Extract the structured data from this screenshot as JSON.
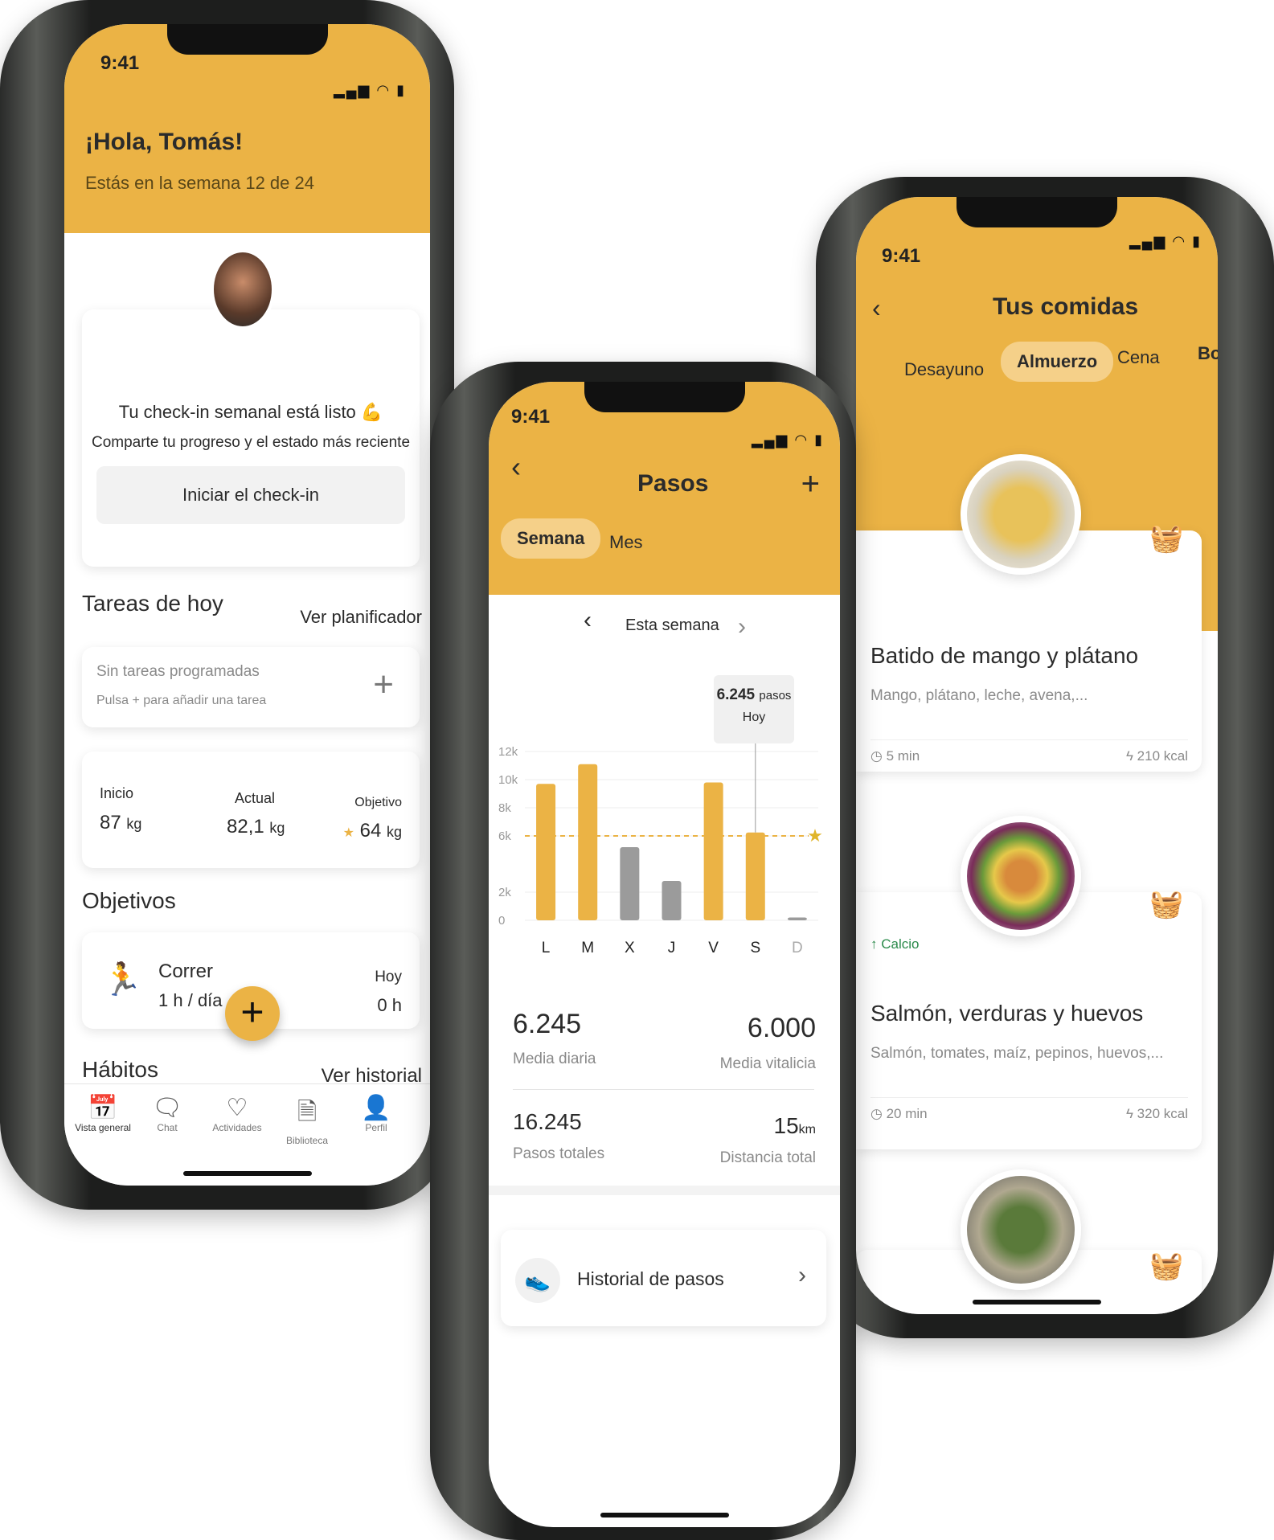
{
  "colors": {
    "accent": "#ebb345",
    "grey_bar": "#9b9b9b",
    "basket": "#2f5bd8"
  },
  "status_time": "9:41",
  "overview": {
    "greeting": "¡Hola, Tomás!",
    "week": "Estás en la semana 12 de 24",
    "checkin": {
      "title": "Tu check-in semanal está listo 💪",
      "subtitle": "Comparte tu progreso y el estado más reciente",
      "button": "Iniciar el check-in"
    },
    "tasks": {
      "title": "Tareas de hoy",
      "link": "Ver planificador",
      "empty": "Sin tareas programadas",
      "hint": "Pulsa + para añadir una tarea"
    },
    "weight": {
      "start_label": "Inicio",
      "start": "87",
      "actual_label": "Actual",
      "actual": "82,1",
      "goal_label": "Objetivo",
      "goal": "64",
      "unit": "kg"
    },
    "goals": {
      "title": "Objetivos",
      "name": "Correr",
      "target_num": "1",
      "target_unit": "h / día",
      "today_label": "Hoy",
      "today_num": "0",
      "today_unit": "h"
    },
    "habits": {
      "title": "Hábitos",
      "link": "Ver historial"
    },
    "nav": [
      {
        "label": "Vista general",
        "icon": "calendar-check-icon"
      },
      {
        "label": "Chat",
        "icon": "chat-icon"
      },
      {
        "label": "Actividades",
        "icon": "heart-pulse-icon"
      },
      {
        "label": "Biblioteca",
        "icon": "document-icon"
      },
      {
        "label": "Perfil",
        "icon": "profile-icon"
      }
    ]
  },
  "steps": {
    "title": "Pasos",
    "tabs": [
      "Semana",
      "Mes"
    ],
    "period": "Esta semana",
    "tooltip": {
      "value": "6.245",
      "unit": "pasos",
      "label": "Hoy"
    },
    "stats": [
      {
        "value": "6.245",
        "label": "Media diaria"
      },
      {
        "value": "6.000",
        "label": "Media vitalicia"
      },
      {
        "value": "16.245",
        "label": "Pasos totales"
      },
      {
        "value": "15",
        "unit": "km",
        "label": "Distancia total"
      }
    ],
    "history": "Historial de pasos"
  },
  "chart_data": {
    "type": "bar",
    "categories": [
      "L",
      "M",
      "X",
      "J",
      "V",
      "S",
      "D"
    ],
    "values": [
      9700,
      11100,
      5200,
      2800,
      9800,
      6245,
      200
    ],
    "goal_met": [
      true,
      true,
      false,
      false,
      true,
      true,
      false
    ],
    "goal_line": 6000,
    "yticks": [
      "0",
      "2k",
      "6k",
      "8k",
      "10k",
      "12k"
    ],
    "ytick_values": [
      0,
      2000,
      6000,
      8000,
      10000,
      12000
    ],
    "ylim": [
      0,
      12000
    ],
    "grid": true
  },
  "meals": {
    "title": "Tus comidas",
    "tabs": [
      "Desayuno",
      "Almuerzo",
      "Cena",
      "Boc"
    ],
    "items": [
      {
        "name": "Batido de mango y plátano",
        "ingredients": "Mango, plátano, leche, avena,...",
        "time": "5 min",
        "kcal": "210 kcal",
        "tag": ""
      },
      {
        "name": "Salmón, verduras y huevos",
        "ingredients": "Salmón, tomates, maíz, pepinos, huevos,...",
        "time": "20 min",
        "kcal": "320 kcal",
        "tag": "Calcio"
      }
    ]
  }
}
